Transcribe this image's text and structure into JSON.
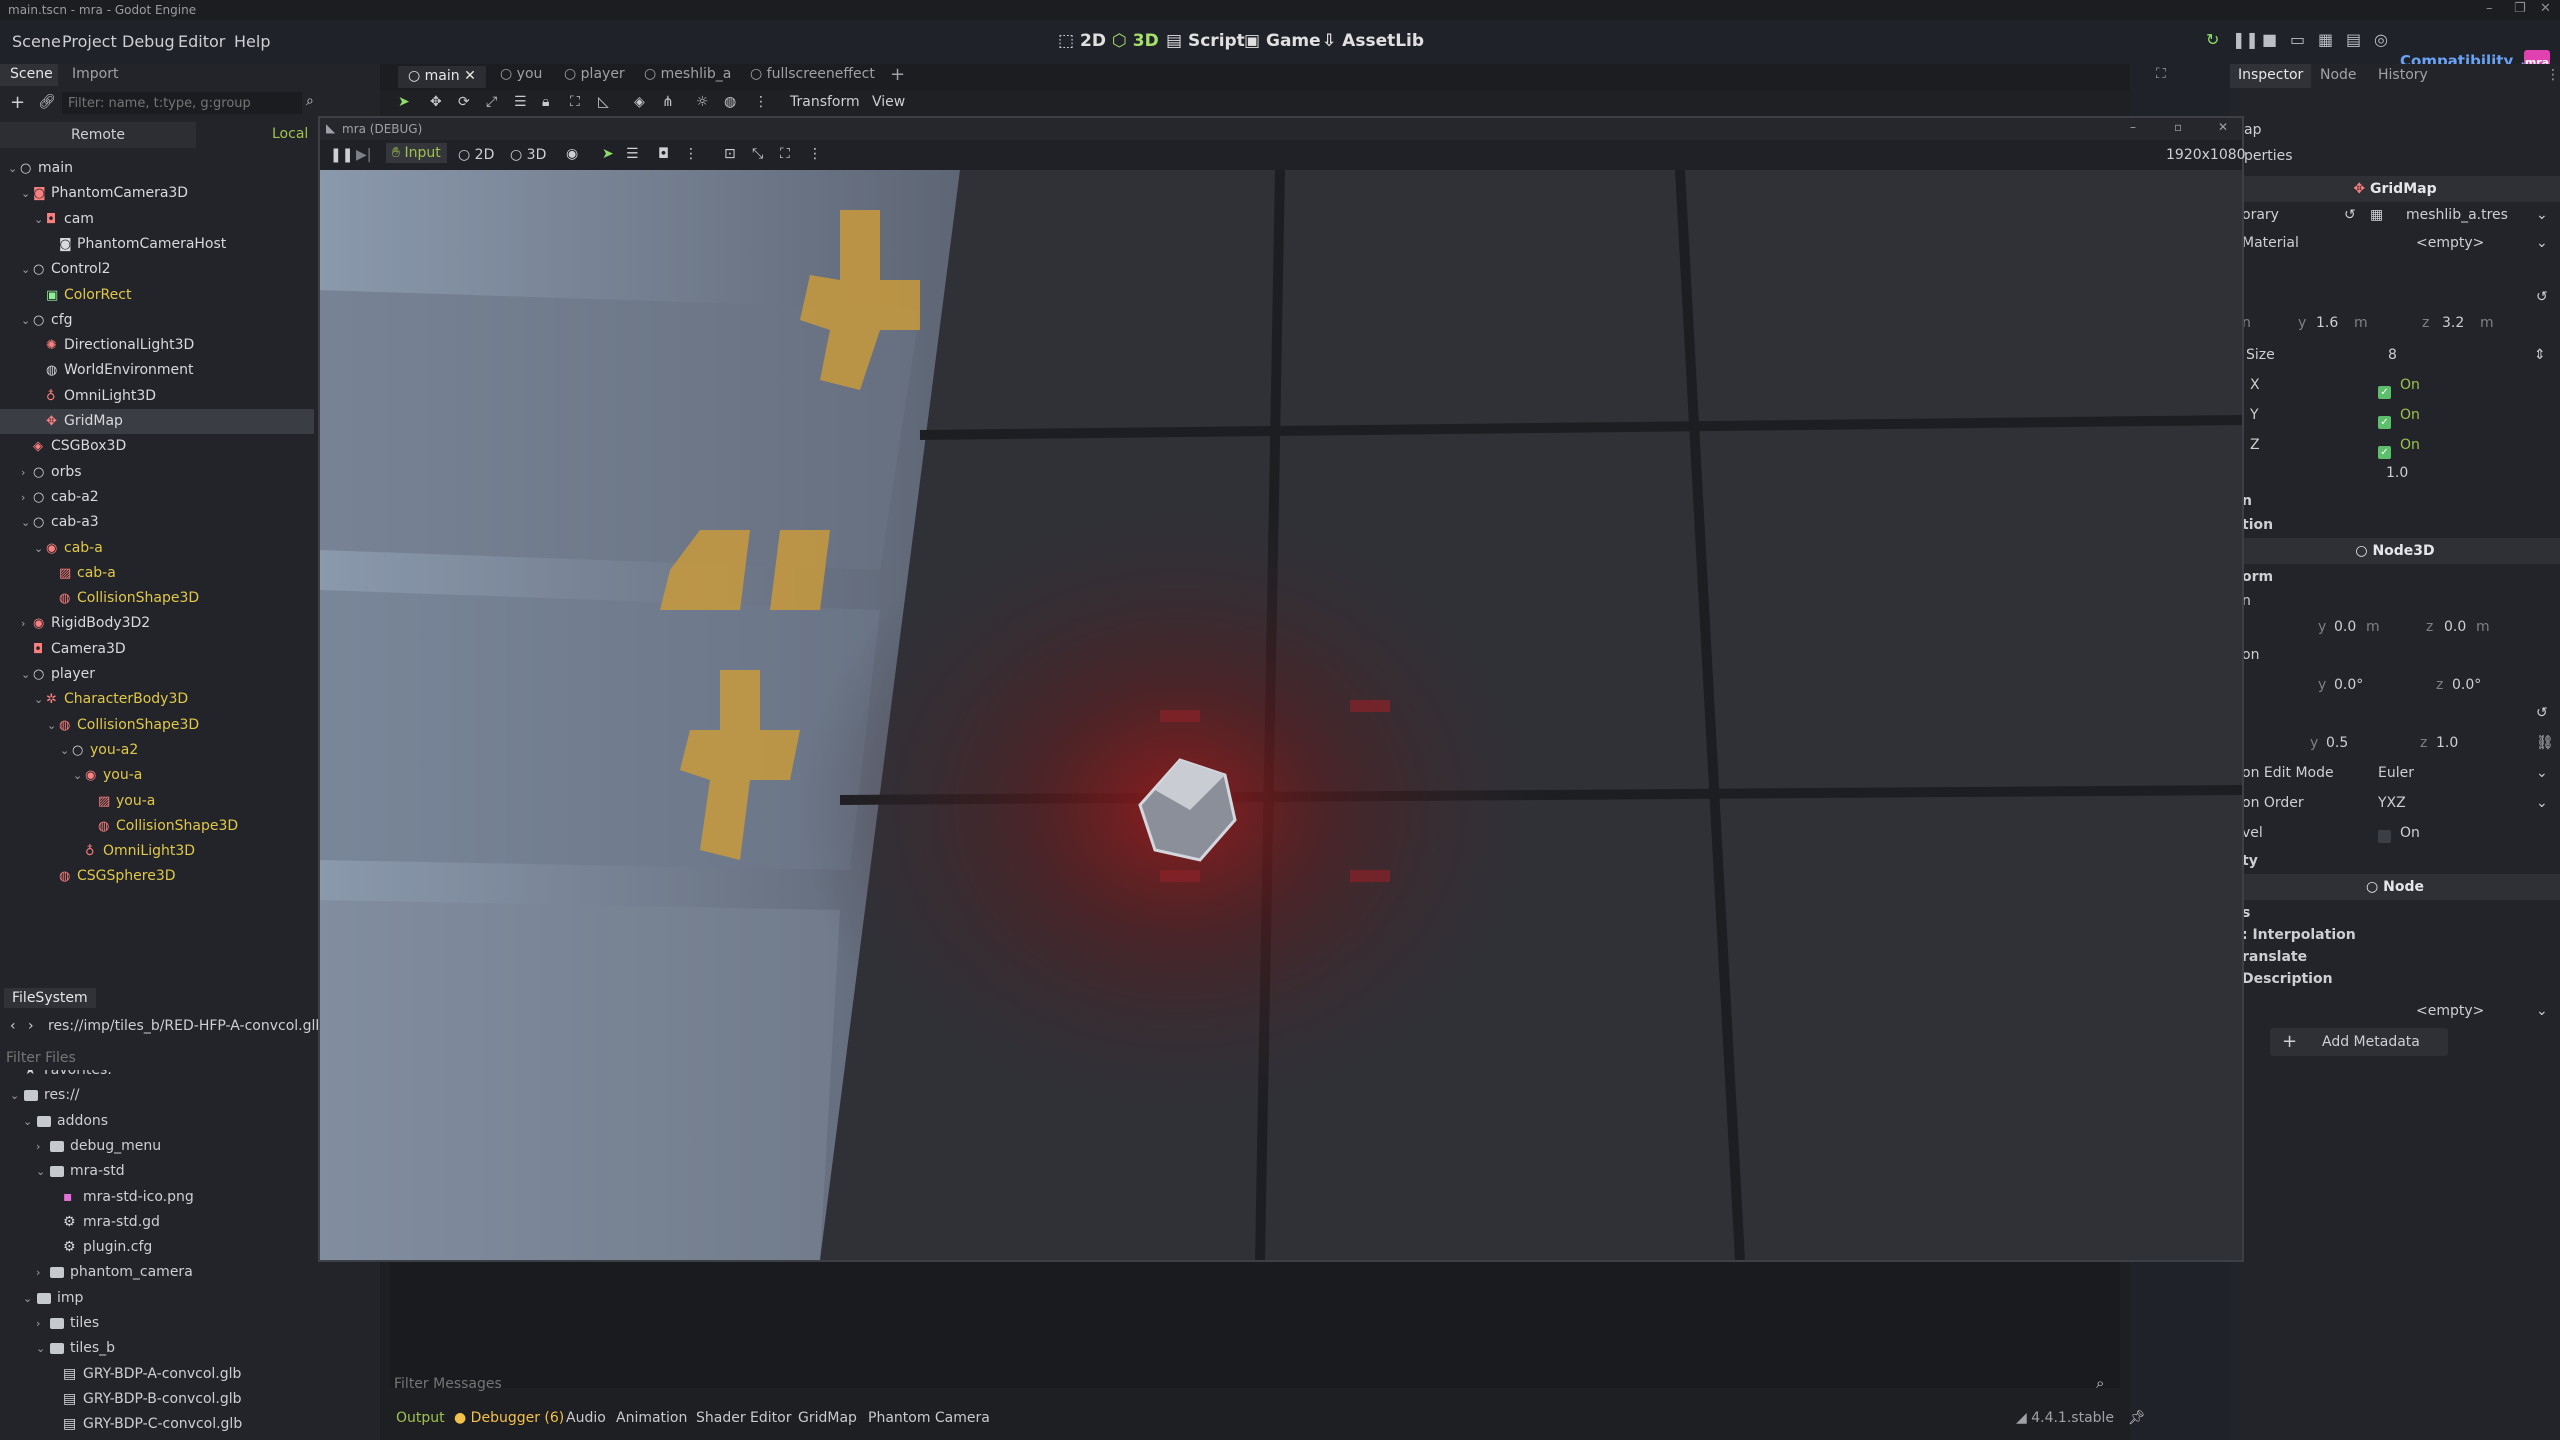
{
  "window": {
    "title": "main.tscn - mra - Godot Engine"
  },
  "menu": {
    "items": [
      "Scene",
      "Project",
      "Debug",
      "Editor",
      "Help"
    ]
  },
  "workspaces": {
    "items": [
      "2D",
      "3D",
      "Script",
      "Game",
      "AssetLib"
    ],
    "active": "3D"
  },
  "renderer": "Compatibility",
  "brand_badge": "mra",
  "left_tabs": {
    "scene": "Scene",
    "import": "Import"
  },
  "scene_filter_placeholder": "Filter: name, t:type, g:group",
  "remote_local": {
    "remote": "Remote",
    "local": "Local"
  },
  "scene_tree": [
    {
      "label": "main",
      "depth": 0,
      "icon": "node-icon",
      "color": "white",
      "arrow": "down"
    },
    {
      "label": "PhantomCamera3D",
      "depth": 1,
      "icon": "phantom-camera-icon",
      "color": "white",
      "arrow": "down"
    },
    {
      "label": "cam",
      "depth": 2,
      "icon": "camera-icon",
      "color": "white",
      "arrow": "down"
    },
    {
      "label": "PhantomCameraHost",
      "depth": 3,
      "icon": "phantom-host-icon",
      "color": "white",
      "arrow": ""
    },
    {
      "label": "Control2",
      "depth": 1,
      "icon": "node-icon",
      "color": "white",
      "arrow": "down"
    },
    {
      "label": "ColorRect",
      "depth": 2,
      "icon": "colorrect-icon",
      "color": "yellow",
      "arrow": ""
    },
    {
      "label": "cfg",
      "depth": 1,
      "icon": "node-icon",
      "color": "white",
      "arrow": "down"
    },
    {
      "label": "DirectionalLight3D",
      "depth": 2,
      "icon": "light-icon",
      "color": "white",
      "arrow": ""
    },
    {
      "label": "WorldEnvironment",
      "depth": 2,
      "icon": "globe-icon",
      "color": "white",
      "arrow": ""
    },
    {
      "label": "OmniLight3D",
      "depth": 2,
      "icon": "omni-light-icon",
      "color": "white",
      "arrow": ""
    },
    {
      "label": "GridMap",
      "depth": 2,
      "icon": "gridmap-icon",
      "color": "white",
      "arrow": "",
      "selected": true
    },
    {
      "label": "CSGBox3D",
      "depth": 1,
      "icon": "csg-box-icon",
      "color": "white",
      "arrow": ""
    },
    {
      "label": "orbs",
      "depth": 1,
      "icon": "node-icon",
      "color": "white",
      "arrow": "right"
    },
    {
      "label": "cab-a2",
      "depth": 1,
      "icon": "node-icon",
      "color": "white",
      "arrow": "right"
    },
    {
      "label": "cab-a3",
      "depth": 1,
      "icon": "node-icon",
      "color": "white",
      "arrow": "down"
    },
    {
      "label": "cab-a",
      "depth": 2,
      "icon": "scene-instance-icon",
      "color": "yellow",
      "arrow": "down"
    },
    {
      "label": "cab-a",
      "depth": 3,
      "icon": "mesh-icon",
      "color": "yellow",
      "arrow": ""
    },
    {
      "label": "CollisionShape3D",
      "depth": 3,
      "icon": "collision-shape-icon",
      "color": "yellow",
      "arrow": ""
    },
    {
      "label": "RigidBody3D2",
      "depth": 1,
      "icon": "rigidbody-icon",
      "color": "white",
      "arrow": "right"
    },
    {
      "label": "Camera3D",
      "depth": 1,
      "icon": "camera-icon",
      "color": "white",
      "arrow": ""
    },
    {
      "label": "player",
      "depth": 1,
      "icon": "node-icon",
      "color": "white",
      "arrow": "down"
    },
    {
      "label": "CharacterBody3D",
      "depth": 2,
      "icon": "character-body-icon",
      "color": "yellow",
      "arrow": "down"
    },
    {
      "label": "CollisionShape3D",
      "depth": 3,
      "icon": "collision-shape-icon",
      "color": "yellow",
      "arrow": "down"
    },
    {
      "label": "you-a2",
      "depth": 4,
      "icon": "node-icon",
      "color": "yellow",
      "arrow": "down"
    },
    {
      "label": "you-a",
      "depth": 5,
      "icon": "scene-instance-icon",
      "color": "yellow",
      "arrow": "down"
    },
    {
      "label": "you-a",
      "depth": 6,
      "icon": "mesh-icon",
      "color": "yellow",
      "arrow": ""
    },
    {
      "label": "CollisionShape3D",
      "depth": 6,
      "icon": "collision-shape-icon",
      "color": "yellow",
      "arrow": ""
    },
    {
      "label": "OmniLight3D",
      "depth": 5,
      "icon": "omni-light-icon",
      "color": "yellow",
      "arrow": ""
    },
    {
      "label": "CSGSphere3D",
      "depth": 3,
      "icon": "csg-sphere-icon",
      "color": "yellow",
      "arrow": ""
    }
  ],
  "filesystem": {
    "tab": "FileSystem",
    "path": "res://imp/tiles_b/RED-HFP-A-convcol.glb",
    "filter_placeholder": "Filter Files",
    "items": [
      {
        "label": "Favorites:",
        "depth": 0,
        "type": "star"
      },
      {
        "label": "res://",
        "depth": 0,
        "type": "folder",
        "arrow": "down"
      },
      {
        "label": "addons",
        "depth": 1,
        "type": "folder",
        "arrow": "down"
      },
      {
        "label": "debug_menu",
        "depth": 2,
        "type": "folder",
        "arrow": "right"
      },
      {
        "label": "mra-std",
        "depth": 2,
        "type": "folder",
        "arrow": "down"
      },
      {
        "label": "mra-std-ico.png",
        "depth": 3,
        "type": "image"
      },
      {
        "label": "mra-std.gd",
        "depth": 3,
        "type": "script"
      },
      {
        "label": "plugin.cfg",
        "depth": 3,
        "type": "config"
      },
      {
        "label": "phantom_camera",
        "depth": 2,
        "type": "folder",
        "arrow": "right"
      },
      {
        "label": "imp",
        "depth": 1,
        "type": "folder",
        "arrow": "down"
      },
      {
        "label": "tiles",
        "depth": 2,
        "type": "folder",
        "arrow": "right"
      },
      {
        "label": "tiles_b",
        "depth": 2,
        "type": "folder",
        "arrow": "down"
      },
      {
        "label": "GRY-BDP-A-convcol.glb",
        "depth": 3,
        "type": "model"
      },
      {
        "label": "GRY-BDP-B-convcol.glb",
        "depth": 3,
        "type": "model"
      },
      {
        "label": "GRY-BDP-C-convcol.glb",
        "depth": 3,
        "type": "model"
      }
    ]
  },
  "scene_tabs": [
    "main",
    "you",
    "player",
    "meshlib_a",
    "fullscreeneffect"
  ],
  "editor_toolbar": {
    "transform": "Transform",
    "view": "View"
  },
  "game_window": {
    "title": "mra (DEBUG)",
    "input": "Input",
    "mode_2d": "2D",
    "mode_3d": "3D",
    "resolution": "1920x1080"
  },
  "bottom": {
    "filter_placeholder": "Filter Messages",
    "tabs": [
      "Output",
      "Debugger (6)",
      "Audio",
      "Animation",
      "Shader Editor",
      "GridMap",
      "Phantom Camera"
    ],
    "version": "4.4.1.stable"
  },
  "inspector": {
    "tabs": [
      "Inspector",
      "Node",
      "History"
    ],
    "node_type": "GridMap",
    "partial_title": "ap",
    "filter_partial": "perties",
    "library_label": "orary",
    "library_value": "meshlib_a.tres",
    "material_label": "Material",
    "material_value": "<empty>",
    "cell_label": "n",
    "cell_y": "1.6",
    "cell_z": "3.2",
    "unit": "m",
    "octant_label": "Size",
    "octant_value": "8",
    "center_x": "X",
    "center_y": "Y",
    "center_z": "Z",
    "on": "On",
    "scale_value": "1.0",
    "physics_label": "n",
    "navigation_label": "tion",
    "node3d_section": "Node3D",
    "transform_label": "orm",
    "pos_label": "n",
    "pos_y": "0.0",
    "pos_z": "0.0",
    "rot_label": "on",
    "rot_y": "0.0°",
    "rot_z": "0.0°",
    "scale_y": "0.5",
    "scale_z": "1.0",
    "rot_mode_label": "on Edit Mode",
    "rot_mode_value": "Euler",
    "rot_order_label": "on Order",
    "rot_order_value": "YXZ",
    "top_level_label": "vel",
    "visibility_label": "ty",
    "node_section": "Node",
    "meta_rows": [
      "s",
      ": Interpolation",
      "ranslate",
      "Description"
    ],
    "editor_desc_value": "<empty>",
    "add_metadata": "Add Metadata"
  }
}
